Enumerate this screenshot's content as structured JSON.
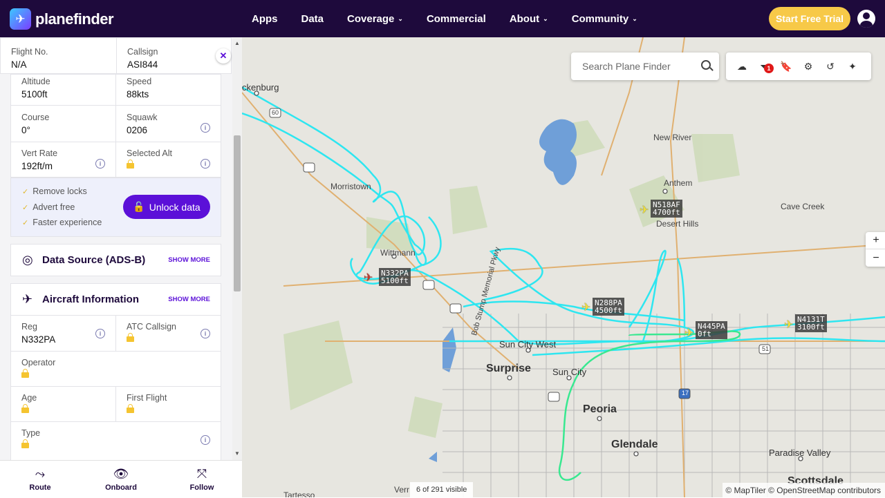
{
  "brand": {
    "name": "planefinder"
  },
  "nav": {
    "items": [
      {
        "label": "Apps",
        "dropdown": false
      },
      {
        "label": "Data",
        "dropdown": false
      },
      {
        "label": "Coverage",
        "dropdown": true
      },
      {
        "label": "Commercial",
        "dropdown": false
      },
      {
        "label": "About",
        "dropdown": true
      },
      {
        "label": "Community",
        "dropdown": true
      }
    ],
    "trial_label": "Start Free Trial"
  },
  "flight": {
    "flight_no_label": "Flight No.",
    "flight_no": "N/A",
    "callsign_label": "Callsign",
    "callsign": "ASI844",
    "altitude_label": "Altitude",
    "altitude": "5100ft",
    "speed_label": "Speed",
    "speed": "88kts",
    "course_label": "Course",
    "course": "0°",
    "squawk_label": "Squawk",
    "squawk": "0206",
    "vert_rate_label": "Vert Rate",
    "vert_rate": "192ft/m",
    "selected_alt_label": "Selected Alt"
  },
  "unlock": {
    "perks": [
      "Remove locks",
      "Advert free",
      "Faster experience"
    ],
    "button_label": "Unlock data"
  },
  "data_source": {
    "title": "Data Source (ADS-B)",
    "more": "SHOW MORE"
  },
  "aircraft_info": {
    "title": "Aircraft Information",
    "more": "SHOW MORE",
    "reg_label": "Reg",
    "reg": "N332PA",
    "atc_callsign_label": "ATC Callsign",
    "operator_label": "Operator",
    "age_label": "Age",
    "first_flight_label": "First Flight",
    "type_label": "Type"
  },
  "tabs": [
    {
      "label": "Route",
      "icon": "route-icon"
    },
    {
      "label": "Onboard",
      "icon": "binoculars-icon"
    },
    {
      "label": "Follow",
      "icon": "follow-icon"
    }
  ],
  "map": {
    "search_placeholder": "Search Plane Finder",
    "filter_badge": "1",
    "visible_count": "6 of 291 visible",
    "attribution": "© MapTiler © OpenStreetMap contributors",
    "zoom_in": "+",
    "zoom_out": "−",
    "places": {
      "wickenburg": "ckenburg",
      "new_river": "New River",
      "anthem": "Anthem",
      "desert_hills": "Desert Hills",
      "cave_creek": "Cave Creek",
      "morristown": "Morristown",
      "wittmann": "Wittmann",
      "sun_city_west": "Sun City West",
      "surprise": "Surprise",
      "sun_city": "Sun City",
      "peoria": "Peoria",
      "glendale": "Glendale",
      "paradise_valley": "Paradise Valley",
      "scottsdale": "Scottsdale",
      "tartesso": "Tartesso",
      "verrado": "Verr",
      "bob_stump": "Bob Stump Memorial Pkwy",
      "highway_60": "60",
      "highway_51": "51",
      "highway_17": "17"
    },
    "aircraft": [
      {
        "callsign": "N332PA",
        "alt": "5100ft",
        "color": "#c0392b"
      },
      {
        "callsign": "N518AF",
        "alt": "4700ft",
        "color": "#f2e23c"
      },
      {
        "callsign": "N288PA",
        "alt": "4500ft",
        "color": "#f2e23c"
      },
      {
        "callsign": "N445PA",
        "alt": "0ft",
        "color": "#f2e23c"
      },
      {
        "callsign": "N4131T",
        "alt": "3100ft",
        "color": "#f2e23c"
      }
    ]
  }
}
